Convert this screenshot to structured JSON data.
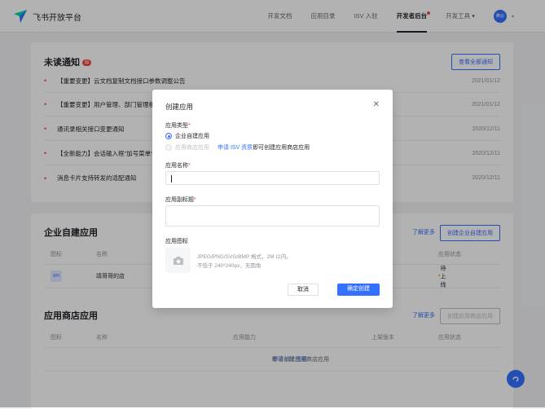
{
  "header": {
    "brand": "飞书开放平台",
    "nav": [
      "开发文档",
      "应用目录",
      "ISV 入驻",
      "开发者后台",
      "开发工具"
    ],
    "avatar": "腾云"
  },
  "notices": {
    "title": "未读通知",
    "count": "11",
    "view_all": "查看全部通知",
    "items": [
      {
        "title": "【重要变更】云文档复制文档接口参数调整公告",
        "date": "2021/01/12"
      },
      {
        "title": "【重要变更】用户管理、部门管理相",
        "date": "2021/01/12"
      },
      {
        "title": "通讯录相关接口变更通知",
        "date": "2020/12/11"
      },
      {
        "title": "【全新能力】会话输入框\"加号菜单\"",
        "date": "2020/12/11"
      },
      {
        "title": "消息卡片支持转发的适配通知",
        "date": "2020/12/11"
      }
    ]
  },
  "custom_apps": {
    "title": "企业自建应用",
    "learn_more": "了解更多",
    "create": "创建企业自建应用",
    "columns": {
      "icon": "图标",
      "name": "名称",
      "status": "应用状态"
    },
    "rows": [
      {
        "icon": "API",
        "name": "靖哥哥的店",
        "status": "待上线"
      }
    ]
  },
  "store_apps": {
    "title": "应用商店应用",
    "learn_more": "了解更多",
    "create": "创建应用商店应用",
    "columns": {
      "icon": "图标",
      "name": "名称",
      "ability": "应用能力",
      "version": "上架版本",
      "status": "应用状态"
    },
    "empty_link": "申请 ISV 资质",
    "empty_text": " 即可创建应用商店应用"
  },
  "modal": {
    "title": "创建应用",
    "type_label": "应用类型",
    "option_custom": "企业自建应用",
    "option_store": "应用商店应用",
    "isv_link": "申请 ISV 资质",
    "isv_text": " 即可创建应用商店应用",
    "name_label": "应用名称",
    "name_value": "",
    "subtitle_label": "应用副标题",
    "subtitle_value": "",
    "icon_label": "应用图标",
    "icon_hint1": "JPEG/PNG/SVG/BMP 格式，2M 以内。",
    "icon_hint2": "不低于 240*240px，无圆角",
    "cancel": "取消",
    "confirm": "确定创建"
  }
}
